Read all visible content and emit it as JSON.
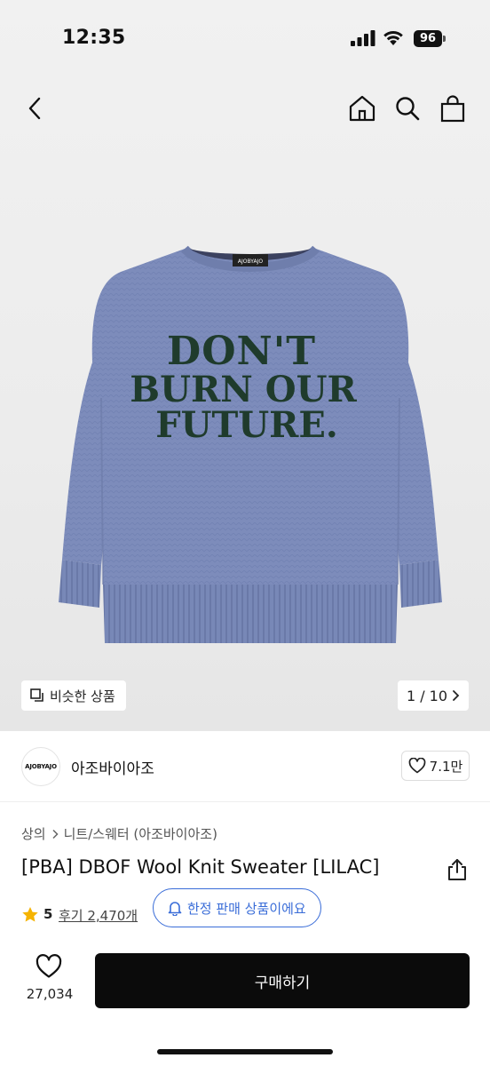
{
  "status_bar": {
    "time": "12:35",
    "battery": "96"
  },
  "gallery": {
    "similar_label": "비슷한 상품",
    "counter": "1 / 10",
    "sweater_text": [
      "DON'T",
      "BURN OUR",
      "FUTURE."
    ],
    "tag_text": "AJOBYAJO",
    "sweater_color": "#7d8cbb",
    "print_color": "#1f3b2c"
  },
  "brand": {
    "logo_text": "AJOBYAJO",
    "name": "아조바이아조",
    "likes": "7.1만"
  },
  "product": {
    "breadcrumb": [
      "상의",
      "니트/스웨터 (아조바이아조)"
    ],
    "title": "[PBA] DBOF Wool Knit Sweater [LILAC]",
    "rating": "5",
    "reviews": "후기 2,470개",
    "limited_label": "한정 판매 상품이에요"
  },
  "bottom_bar": {
    "wish_count": "27,034",
    "buy_label": "구매하기"
  },
  "colors": {
    "accent_blue": "#3a6dd8",
    "star": "#f5b301",
    "button_black": "#0b0b0b"
  }
}
